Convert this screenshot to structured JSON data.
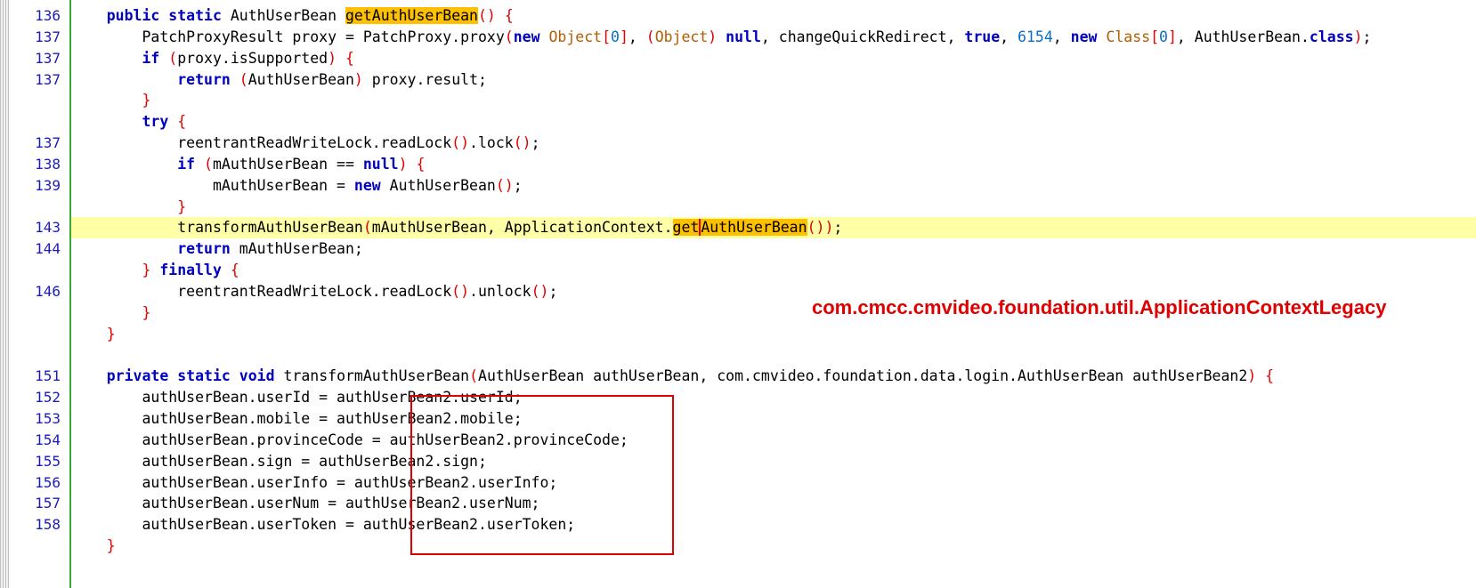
{
  "editor": {
    "lines": [
      {
        "ln": "136",
        "segments": [
          [
            "    ",
            ""
          ],
          [
            "public",
            "kw"
          ],
          [
            " ",
            ""
          ],
          [
            "static",
            "kw"
          ],
          [
            " AuthUserBean ",
            ""
          ],
          [
            "getAuthUserBean",
            "hl"
          ],
          [
            "()",
            "br"
          ],
          [
            " ",
            ""
          ],
          [
            "{",
            "br"
          ]
        ]
      },
      {
        "ln": "137",
        "segments": [
          [
            "        PatchProxyResult proxy = PatchProxy.proxy",
            ""
          ],
          [
            "(",
            "br"
          ],
          [
            "new",
            "kw"
          ],
          [
            " ",
            ""
          ],
          [
            "Object",
            "ty"
          ],
          [
            "[",
            "br"
          ],
          [
            "0",
            "num"
          ],
          [
            "]",
            "br"
          ],
          [
            ", ",
            ""
          ],
          [
            "(",
            "br"
          ],
          [
            "Object",
            "ty"
          ],
          [
            ")",
            "br"
          ],
          [
            " ",
            ""
          ],
          [
            "null",
            "kw"
          ],
          [
            ", changeQuickRedirect, ",
            ""
          ],
          [
            "true",
            "kw"
          ],
          [
            ", ",
            ""
          ],
          [
            "6154",
            "num"
          ],
          [
            ", ",
            ""
          ],
          [
            "new",
            "kw"
          ],
          [
            " ",
            ""
          ],
          [
            "Class",
            "ty"
          ],
          [
            "[",
            "br"
          ],
          [
            "0",
            "num"
          ],
          [
            "]",
            "br"
          ],
          [
            ", AuthUserBean.",
            ""
          ],
          [
            "class",
            "kw"
          ],
          [
            ")",
            "br"
          ],
          [
            ";",
            ""
          ]
        ]
      },
      {
        "ln": "137",
        "segments": [
          [
            "        ",
            ""
          ],
          [
            "if",
            "kw"
          ],
          [
            " ",
            ""
          ],
          [
            "(",
            "br"
          ],
          [
            "proxy.isSupported",
            ""
          ],
          [
            ")",
            "br"
          ],
          [
            " ",
            ""
          ],
          [
            "{",
            "br"
          ]
        ]
      },
      {
        "ln": "137",
        "segments": [
          [
            "            ",
            ""
          ],
          [
            "return",
            "kw"
          ],
          [
            " ",
            ""
          ],
          [
            "(",
            "br"
          ],
          [
            "AuthUserBean",
            ""
          ],
          [
            ")",
            "br"
          ],
          [
            " proxy.result;",
            ""
          ]
        ]
      },
      {
        "ln": "",
        "segments": [
          [
            "        ",
            ""
          ],
          [
            "}",
            "br"
          ]
        ]
      },
      {
        "ln": "",
        "segments": [
          [
            "        ",
            ""
          ],
          [
            "try",
            "kw"
          ],
          [
            " ",
            ""
          ],
          [
            "{",
            "br"
          ]
        ]
      },
      {
        "ln": "137",
        "segments": [
          [
            "            reentrantReadWriteLock.readLock",
            ""
          ],
          [
            "()",
            "br"
          ],
          [
            ".lock",
            ""
          ],
          [
            "()",
            "br"
          ],
          [
            ";",
            ""
          ]
        ]
      },
      {
        "ln": "138",
        "segments": [
          [
            "            ",
            ""
          ],
          [
            "if",
            "kw"
          ],
          [
            " ",
            ""
          ],
          [
            "(",
            "br"
          ],
          [
            "mAuthUserBean == ",
            ""
          ],
          [
            "null",
            "kw"
          ],
          [
            ")",
            "br"
          ],
          [
            " ",
            ""
          ],
          [
            "{",
            "br"
          ]
        ]
      },
      {
        "ln": "139",
        "segments": [
          [
            "                mAuthUserBean = ",
            ""
          ],
          [
            "new",
            "kw"
          ],
          [
            " AuthUserBean",
            ""
          ],
          [
            "()",
            "br"
          ],
          [
            ";",
            ""
          ]
        ]
      },
      {
        "ln": "",
        "segments": [
          [
            "            ",
            ""
          ],
          [
            "}",
            "br"
          ]
        ]
      },
      {
        "ln": "143",
        "current": true,
        "segments": [
          [
            "            transformAuthUserBean",
            ""
          ],
          [
            "(",
            "br"
          ],
          [
            "mAuthUserBean, ApplicationContext.",
            ""
          ],
          [
            "get",
            "hl"
          ],
          [
            "AuthUserBean",
            "hl cursor"
          ],
          [
            "()",
            "br"
          ],
          [
            ")",
            "br"
          ],
          [
            ";",
            ""
          ]
        ]
      },
      {
        "ln": "144",
        "segments": [
          [
            "            ",
            ""
          ],
          [
            "return",
            "kw"
          ],
          [
            " mAuthUserBean;",
            ""
          ]
        ]
      },
      {
        "ln": "",
        "segments": [
          [
            "        ",
            ""
          ],
          [
            "}",
            "br"
          ],
          [
            " ",
            ""
          ],
          [
            "finally",
            "kw"
          ],
          [
            " ",
            ""
          ],
          [
            "{",
            "br"
          ]
        ]
      },
      {
        "ln": "146",
        "segments": [
          [
            "            reentrantReadWriteLock.readLock",
            ""
          ],
          [
            "()",
            "br"
          ],
          [
            ".unlock",
            ""
          ],
          [
            "()",
            "br"
          ],
          [
            ";",
            ""
          ]
        ]
      },
      {
        "ln": "",
        "segments": [
          [
            "        ",
            ""
          ],
          [
            "}",
            "br"
          ]
        ]
      },
      {
        "ln": "",
        "segments": [
          [
            "    ",
            ""
          ],
          [
            "}",
            "br"
          ]
        ]
      },
      {
        "ln": "",
        "segments": []
      },
      {
        "ln": "151",
        "segments": [
          [
            "    ",
            ""
          ],
          [
            "private",
            "kw"
          ],
          [
            " ",
            ""
          ],
          [
            "static",
            "kw"
          ],
          [
            " ",
            ""
          ],
          [
            "void",
            "kw"
          ],
          [
            " transformAuthUserBean",
            ""
          ],
          [
            "(",
            "br"
          ],
          [
            "AuthUserBean authUserBean, com.cmvideo.foundation.data.login.AuthUserBean authUserBean2",
            ""
          ],
          [
            ")",
            "br"
          ],
          [
            " ",
            ""
          ],
          [
            "{",
            "br"
          ]
        ]
      },
      {
        "ln": "152",
        "segments": [
          [
            "        authUserBean.userId = authUserBean2.userId;",
            ""
          ]
        ]
      },
      {
        "ln": "153",
        "segments": [
          [
            "        authUserBean.mobile = authUserBean2.mobile;",
            ""
          ]
        ]
      },
      {
        "ln": "154",
        "segments": [
          [
            "        authUserBean.provinceCode = authUserBean2.provinceCode;",
            ""
          ]
        ]
      },
      {
        "ln": "155",
        "segments": [
          [
            "        authUserBean.sign = authUserBean2.sign;",
            ""
          ]
        ]
      },
      {
        "ln": "156",
        "segments": [
          [
            "        authUserBean.userInfo = authUserBean2.userInfo;",
            ""
          ]
        ]
      },
      {
        "ln": "157",
        "segments": [
          [
            "        authUserBean.userNum = authUserBean2.userNum;",
            ""
          ]
        ]
      },
      {
        "ln": "158",
        "segments": [
          [
            "        authUserBean.userToken = authUserBean2.userToken;",
            ""
          ]
        ]
      },
      {
        "ln": "",
        "segments": [
          [
            "    ",
            ""
          ],
          [
            "}",
            "br"
          ]
        ]
      }
    ]
  },
  "annotation": {
    "text": "com.cmcc.cmvideo.foundation.util.ApplicationContextLegacy"
  },
  "colors": {
    "keyword": "#0000c0",
    "number": "#0d6ec4",
    "type": "#b35c00",
    "bracket": "#e00000",
    "line_number": "#1c1cb8",
    "current_line": "#ffffa8",
    "search_highlight": "#ffc000",
    "annotation": "#e00000",
    "gutter_border": "#35a835"
  }
}
